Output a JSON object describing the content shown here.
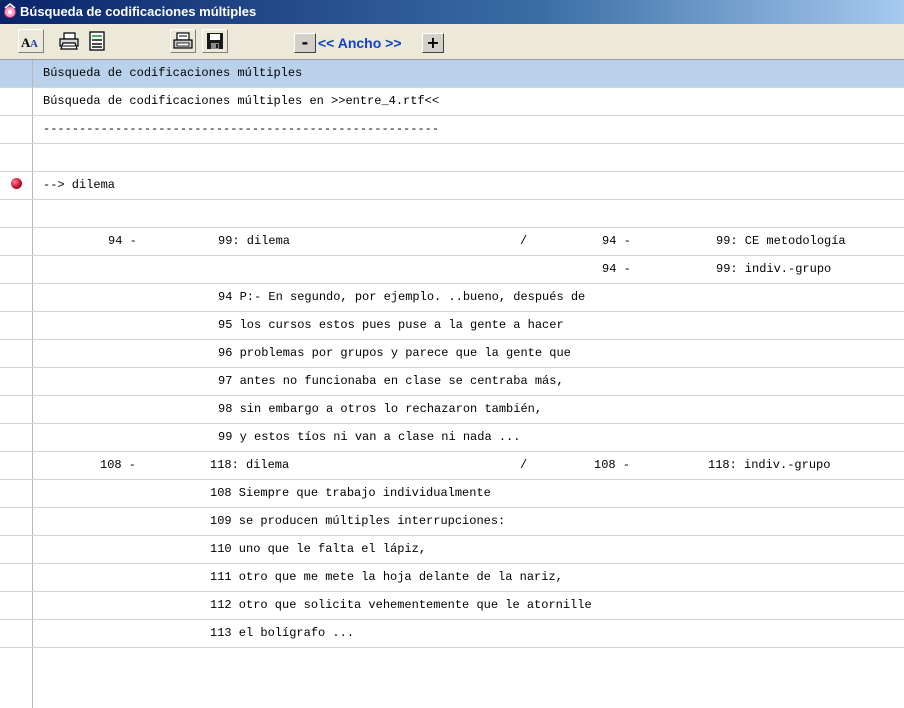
{
  "window": {
    "title": "Búsqueda de codificaciones múltiples"
  },
  "toolbar": {
    "buttons": [
      {
        "name": "font-button",
        "icon": "font-size-icon"
      },
      {
        "name": "print-button",
        "icon": "printer-icon"
      },
      {
        "name": "print-preview-button",
        "icon": "document-lines-icon"
      },
      {
        "name": "export-button",
        "icon": "export-printer-icon"
      },
      {
        "name": "save-button",
        "icon": "floppy-disk-icon"
      }
    ],
    "minus_label": "-",
    "width_label": "<< Ancho >>",
    "plus_label": "+"
  },
  "colors": {
    "header_row": "#b9d1ea",
    "marker": "#c8102e",
    "width_label": "#1240c8"
  },
  "rows": [
    {
      "type": "header",
      "text": "Búsqueda de codificaciones múltiples"
    },
    {
      "type": "text",
      "text": "Búsqueda de codificaciones múltiples en >>entre_4.rtf<<"
    },
    {
      "type": "text",
      "text": "-------------------------------------------------------"
    },
    {
      "type": "text",
      "text": ""
    },
    {
      "type": "marker",
      "text": "--> dilema"
    },
    {
      "type": "text",
      "text": ""
    },
    {
      "type": "match",
      "cols": [
        "94 -",
        "99: dilema",
        "/",
        "94 -",
        "99: CE metodología"
      ]
    },
    {
      "type": "match",
      "cols": [
        "",
        "",
        "",
        "94 -",
        "99: indiv.-grupo"
      ]
    },
    {
      "type": "quote",
      "text": "94 P:- En segundo, por ejemplo. ..bueno, después de"
    },
    {
      "type": "quote",
      "text": "95 los cursos estos pues puse a la gente a hacer"
    },
    {
      "type": "quote",
      "text": "96 problemas por grupos y parece que la gente que"
    },
    {
      "type": "quote",
      "text": "97 antes no funcionaba en clase se centraba más,"
    },
    {
      "type": "quote",
      "text": "98 sin embargo a otros lo rechazaron también,"
    },
    {
      "type": "quote",
      "text": "99 y estos tíos ni van a clase ni nada ..."
    },
    {
      "type": "match",
      "cols": [
        "108 -",
        "118: dilema",
        "/",
        "108 -",
        "118: indiv.-grupo"
      ]
    },
    {
      "type": "quote",
      "text": "108 Siempre que trabajo individualmente"
    },
    {
      "type": "quote",
      "text": "109 se producen múltiples interrupciones:"
    },
    {
      "type": "quote",
      "text": "110 uno que le falta el lápiz,"
    },
    {
      "type": "quote",
      "text": "111 otro que me mete la hoja delante de la nariz,"
    },
    {
      "type": "quote",
      "text": "112 otro que solicita vehementemente que le atornille"
    },
    {
      "type": "quote",
      "text": "113 el bolígrafo ..."
    }
  ]
}
